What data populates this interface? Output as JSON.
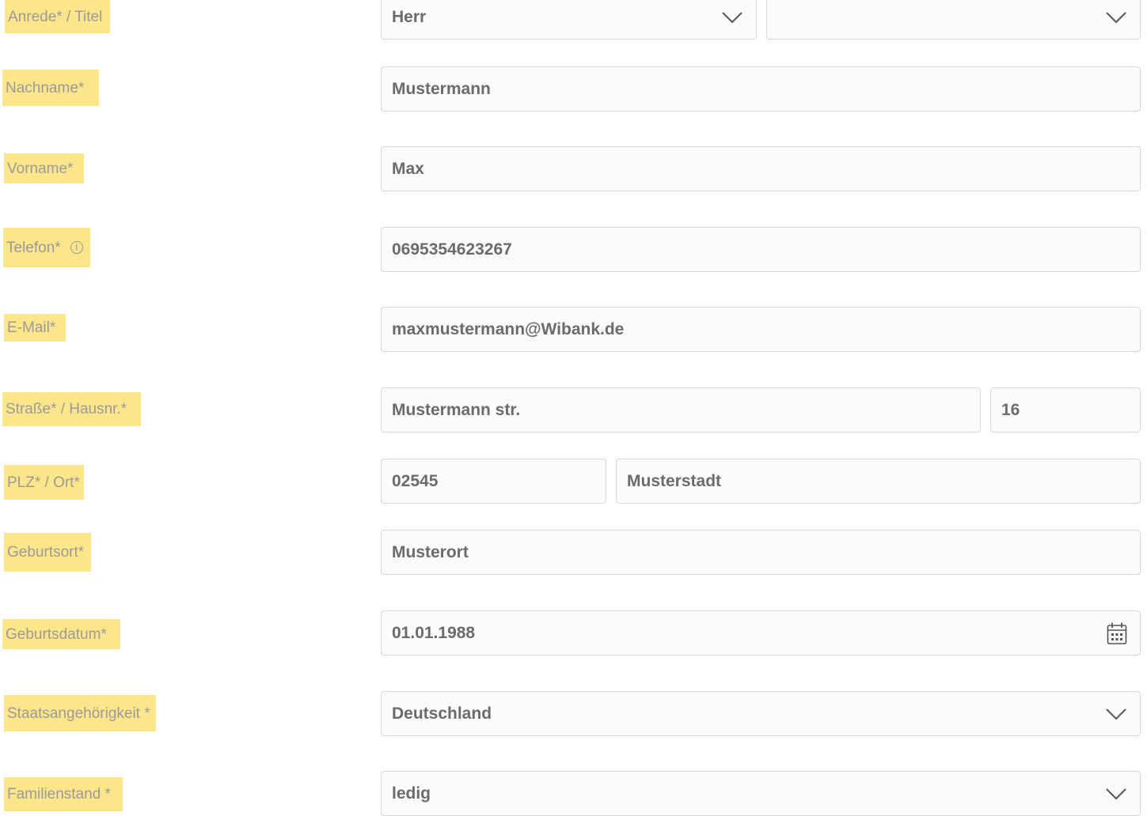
{
  "form": {
    "labels": {
      "anrede": "Anrede* / Titel",
      "nachname": "Nachname*",
      "vorname": "Vorname*",
      "telefon": "Telefon*",
      "email": "E-Mail*",
      "strasse": "Straße* / Hausnr.*",
      "plz_ort": "PLZ* / Ort*",
      "geburtsort": "Geburtsort*",
      "geburtsdatum": "Geburtsdatum*",
      "staatsangehoerigkeit": "Staatsangehörigkeit *",
      "familienstand": "Familienstand *"
    },
    "values": {
      "anrede": "Herr",
      "titel": "",
      "nachname": "Mustermann",
      "vorname": "Max",
      "telefon": "0695354623267",
      "email": "maxmustermann@Wibank.de",
      "strasse": "Mustermann str.",
      "hausnr": "16",
      "plz": "02545",
      "ort": "Musterstadt",
      "geburtsort": "Musterort",
      "geburtsdatum": "01.01.1988",
      "staatsangehoerigkeit": "Deutschland",
      "familienstand": "ledig"
    },
    "icons": {
      "info": "info-icon",
      "dropdown": "chevron-down-icon",
      "calendar": "calendar-icon"
    },
    "colors": {
      "label_highlight": "#fde68a",
      "label_text": "#9a9a9a",
      "field_text": "#6b6b6b",
      "field_border": "#d8d8d8"
    }
  }
}
